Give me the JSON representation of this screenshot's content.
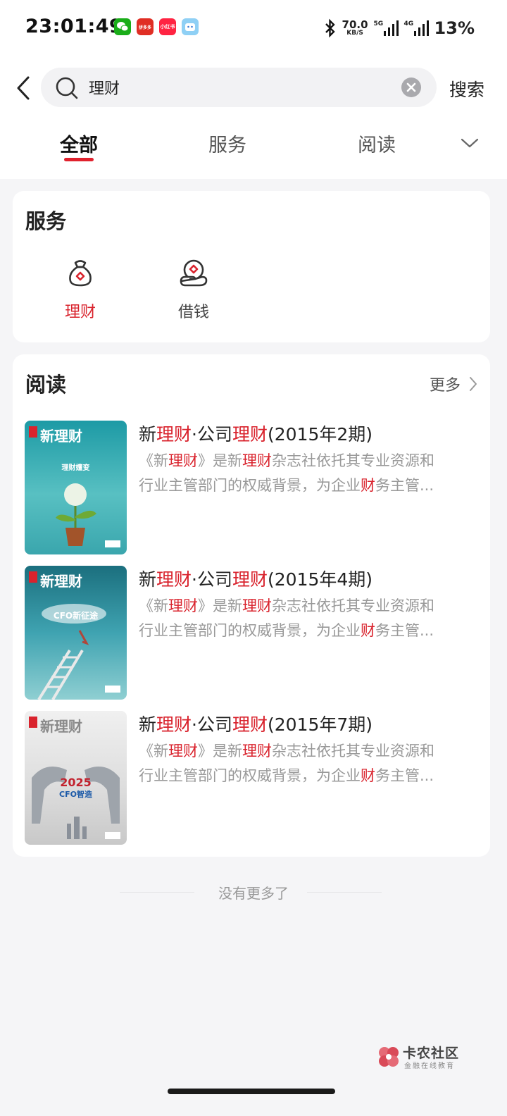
{
  "status_bar": {
    "time": "23:01:49",
    "net_speed_value": "70.0",
    "net_speed_unit": "KB/S",
    "signal1_label": "5G",
    "signal2_label": "4G",
    "battery": "13%",
    "notification_apps": [
      "wechat",
      "pinduoduo",
      "xiaohongshu",
      "other-app"
    ],
    "icon_app1_text": "",
    "icon_app2_text": "拼多多",
    "icon_app3_text": "小红书"
  },
  "search": {
    "query": "理财",
    "submit_label": "搜索"
  },
  "tabs": [
    {
      "label": "全部",
      "active": true
    },
    {
      "label": "服务",
      "active": false
    },
    {
      "label": "阅读",
      "active": false
    }
  ],
  "services": {
    "title": "服务",
    "items": [
      {
        "label": "理财",
        "icon": "money-bag-icon",
        "active": true,
        "color": "#d9232d"
      },
      {
        "label": "借钱",
        "icon": "hand-coin-icon",
        "active": false,
        "color": "#444444"
      }
    ]
  },
  "reading": {
    "title": "阅读",
    "more_label": "更多",
    "highlight_color": "#d9232d",
    "books": [
      {
        "cover_title": "新理财",
        "cover_tag": "理财嬗变",
        "title_parts": [
          "新",
          "理财",
          "·公司",
          "理财",
          "(2015年2期)"
        ],
        "desc_line1_parts": [
          "《新",
          "理财",
          "》是新",
          "理财",
          "杂志社依托其专业资源和"
        ],
        "desc_line2_parts": [
          "行业主管部门的权威背景，为企业",
          "财",
          "务主管..."
        ]
      },
      {
        "cover_title": "新理财",
        "cover_tag": "CFO新征途",
        "title_parts": [
          "新",
          "理财",
          "·公司",
          "理财",
          "(2015年4期)"
        ],
        "desc_line1_parts": [
          "《新",
          "理财",
          "》是新",
          "理财",
          "杂志社依托其专业资源和"
        ],
        "desc_line2_parts": [
          "行业主管部门的权威背景，为企业",
          "财",
          "务主管..."
        ]
      },
      {
        "cover_title": "新理财",
        "cover_tag": "2025",
        "cover_tag2": "CFO智造",
        "title_parts": [
          "新",
          "理财",
          "·公司",
          "理财",
          "(2015年7期)"
        ],
        "desc_line1_parts": [
          "《新",
          "理财",
          "》是新",
          "理财",
          "杂志社依托其专业资源和"
        ],
        "desc_line2_parts": [
          "行业主管部门的权威背景，为企业",
          "财",
          "务主管..."
        ]
      }
    ]
  },
  "end_text": "没有更多了",
  "watermark": {
    "name": "卡农社区",
    "subtitle": "金融在线教育"
  }
}
